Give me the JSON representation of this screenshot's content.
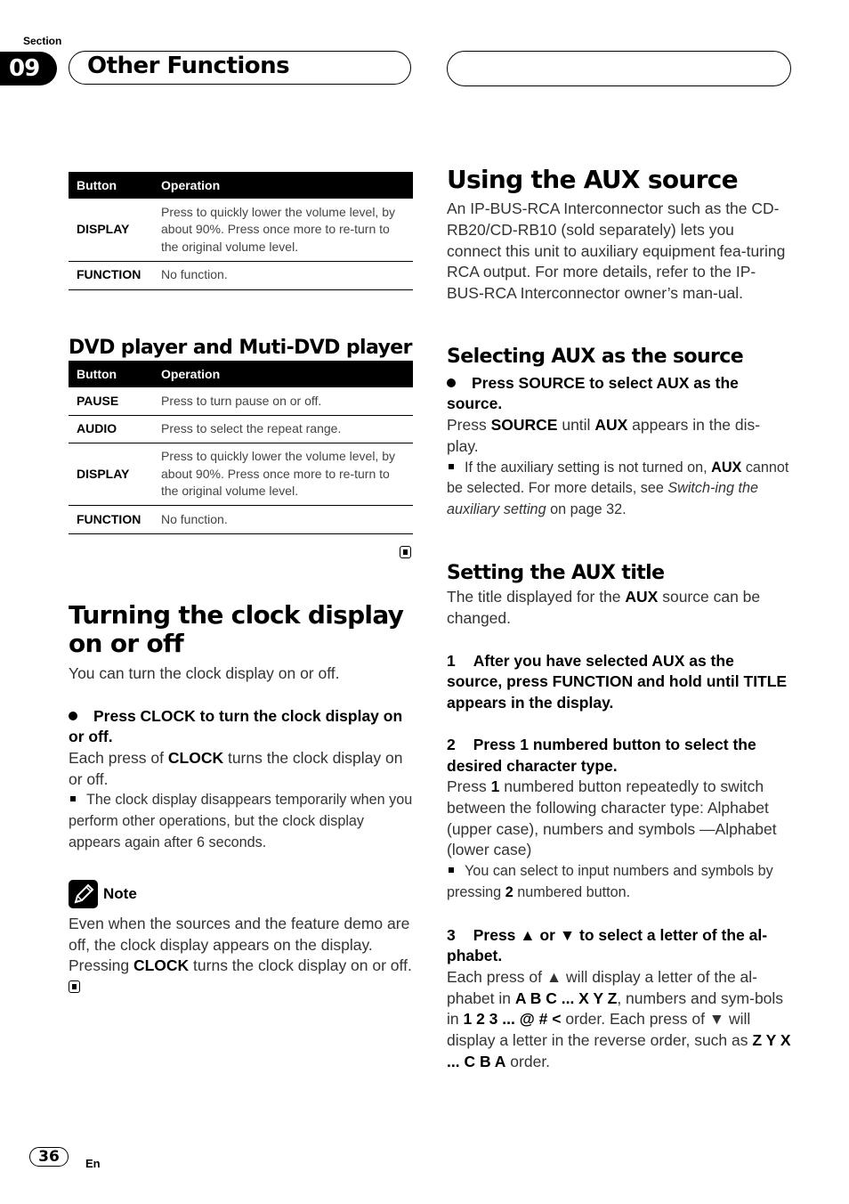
{
  "header": {
    "section_label": "Section",
    "section_number": "09",
    "section_title": "Other Functions"
  },
  "table1": {
    "headers": [
      "Button",
      "Operation"
    ],
    "rows": [
      {
        "button": "DISPLAY",
        "operation": "Press to quickly lower the volume level, by about 90%. Press once more to re-turn to the original volume level."
      },
      {
        "button": "FUNCTION",
        "operation": "No function."
      }
    ]
  },
  "dvd": {
    "heading": "DVD player and Muti-DVD player",
    "headers": [
      "Button",
      "Operation"
    ],
    "rows": [
      {
        "button": "PAUSE",
        "operation": "Press to turn pause on or off."
      },
      {
        "button": "AUDIO",
        "operation": "Press to select the repeat range."
      },
      {
        "button": "DISPLAY",
        "operation": "Press to quickly lower the volume level, by about 90%. Press once more to re-turn to the original volume level."
      },
      {
        "button": "FUNCTION",
        "operation": "No function."
      }
    ]
  },
  "clock": {
    "heading": "Turning the clock display on or off",
    "intro": "You can turn the clock display on or off.",
    "step": "Press CLOCK to turn the clock display on or off.",
    "desc_pre": "Each press of ",
    "desc_bold": "CLOCK",
    "desc_post": " turns the clock display on or off.",
    "tip": "The clock display disappears temporarily when you perform other operations, but the clock display appears again after 6 seconds.",
    "note_label": "Note",
    "note_pre": "Even when the sources and the feature demo are off, the clock display appears on the display. Pressing ",
    "note_bold": "CLOCK",
    "note_post": " turns the clock display on or off."
  },
  "aux": {
    "heading": "Using the AUX source",
    "intro": "An IP-BUS-RCA Interconnector such as the CD-RB20/CD-RB10 (sold separately) lets you connect this unit to auxiliary equipment fea-turing RCA output. For more details, refer to the IP-BUS-RCA Interconnector owner’s man-ual.",
    "select": {
      "heading": "Selecting AUX as the source",
      "step": "Press SOURCE to select AUX as the source.",
      "desc_1": "Press ",
      "desc_b1": "SOURCE",
      "desc_2": " until ",
      "desc_b2": "AUX",
      "desc_3": " appears in the dis-play.",
      "tip_1": "If the auxiliary setting is not turned on, ",
      "tip_b": "AUX",
      "tip_2": " cannot be selected. For more details, see ",
      "tip_i": "Switch-ing the auxiliary setting",
      "tip_3": " on page 32."
    },
    "title": {
      "heading": "Setting the AUX title",
      "intro_1": "The title displayed for the ",
      "intro_b": "AUX",
      "intro_2": " source can be changed.",
      "step1_num": "1",
      "step1": "After you have selected AUX as the source, press FUNCTION and hold until TITLE appears in the display.",
      "step2_num": "2",
      "step2": "Press 1 numbered button to select the desired character type.",
      "step2_desc_1": "Press ",
      "step2_desc_b": "1",
      "step2_desc_2": " numbered button repeatedly to switch between the following character type: Alphabet (upper case), numbers and symbols —Alphabet (lower case)",
      "step2_tip_1": "You can select to input numbers and symbols by pressing ",
      "step2_tip_b": "2",
      "step2_tip_2": " numbered button.",
      "step3_num": "3",
      "step3": "Press ▲ or ▼ to select a letter of the al-phabet.",
      "step3_d1": "Each press of ▲ will display a letter of the al-phabet in ",
      "step3_b1": "A B C ... X Y Z",
      "step3_d2": ", numbers and sym-bols in ",
      "step3_b2": "1 2 3 ... @ # <",
      "step3_d3": " order. Each press of ▼ will display a letter in the reverse order, such as ",
      "step3_b3": "Z Y X ... C B A",
      "step3_d4": " order."
    }
  },
  "footer": {
    "page_number": "36",
    "language": "En"
  }
}
